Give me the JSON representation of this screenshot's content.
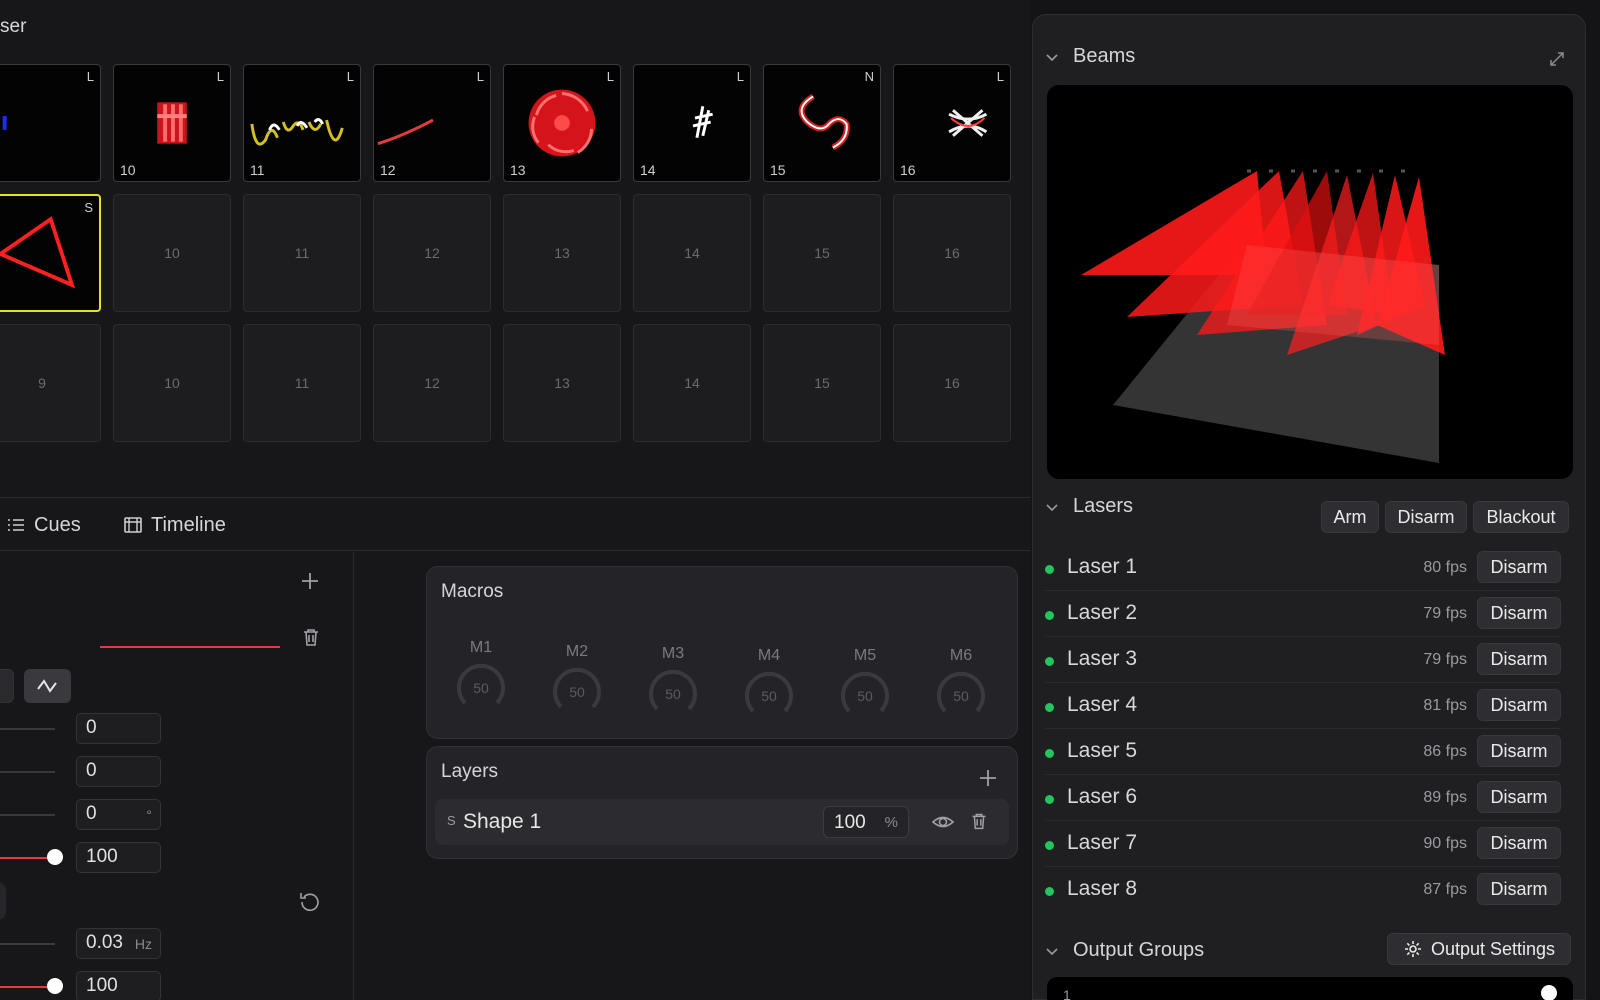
{
  "left": {
    "title": "ser",
    "thumb_row": [
      {
        "num": "",
        "tag": "L"
      },
      {
        "num": "10",
        "tag": "L"
      },
      {
        "num": "11",
        "tag": "L"
      },
      {
        "num": "12",
        "tag": "L"
      },
      {
        "num": "13",
        "tag": "L"
      },
      {
        "num": "14",
        "tag": "L"
      },
      {
        "num": "15",
        "tag": "N"
      },
      {
        "num": "16",
        "tag": "L"
      }
    ],
    "row2": [
      {
        "label": "",
        "tag": "S"
      },
      {
        "label": "10"
      },
      {
        "label": "11"
      },
      {
        "label": "12"
      },
      {
        "label": "13"
      },
      {
        "label": "14"
      },
      {
        "label": "15"
      },
      {
        "label": "16"
      }
    ],
    "row3": [
      "9",
      "10",
      "11",
      "12",
      "13",
      "14",
      "15",
      "16"
    ]
  },
  "tabs": {
    "cues": "Cues",
    "timeline": "Timeline"
  },
  "editor": {
    "fields": [
      {
        "value": "0",
        "unit": ""
      },
      {
        "value": "0",
        "unit": ""
      },
      {
        "value": "0",
        "unit": "°"
      },
      {
        "value": "100",
        "unit": ""
      },
      {
        "value": "0.03",
        "unit": "Hz"
      },
      {
        "value": "100",
        "unit": ""
      }
    ]
  },
  "macros": {
    "title": "Macros",
    "items": [
      {
        "label": "M1",
        "value": "50"
      },
      {
        "label": "M2",
        "value": "50"
      },
      {
        "label": "M3",
        "value": "50"
      },
      {
        "label": "M4",
        "value": "50"
      },
      {
        "label": "M5",
        "value": "50"
      },
      {
        "label": "M6",
        "value": "50"
      }
    ]
  },
  "layers": {
    "title": "Layers",
    "items": [
      {
        "prefix": "S",
        "name": "Shape 1",
        "opacity": "100",
        "unit": "%"
      }
    ]
  },
  "right": {
    "beams_title": "Beams",
    "lasers_title": "Lasers",
    "arm": "Arm",
    "disarm": "Disarm",
    "blackout": "Blackout",
    "lasers": [
      {
        "name": "Laser 1",
        "fps": "80 fps",
        "action": "Disarm"
      },
      {
        "name": "Laser 2",
        "fps": "79 fps",
        "action": "Disarm"
      },
      {
        "name": "Laser 3",
        "fps": "79 fps",
        "action": "Disarm"
      },
      {
        "name": "Laser 4",
        "fps": "81 fps",
        "action": "Disarm"
      },
      {
        "name": "Laser 5",
        "fps": "86 fps",
        "action": "Disarm"
      },
      {
        "name": "Laser 6",
        "fps": "89 fps",
        "action": "Disarm"
      },
      {
        "name": "Laser 7",
        "fps": "90 fps",
        "action": "Disarm"
      },
      {
        "name": "Laser 8",
        "fps": "87 fps",
        "action": "Disarm"
      }
    ],
    "output_groups_title": "Output Groups",
    "output_settings": "Output Settings",
    "output_group_first": "1"
  },
  "colors": {
    "accent_red": "#e23c3c",
    "selected_yellow": "#e6e020",
    "status_green": "#22c55e"
  }
}
